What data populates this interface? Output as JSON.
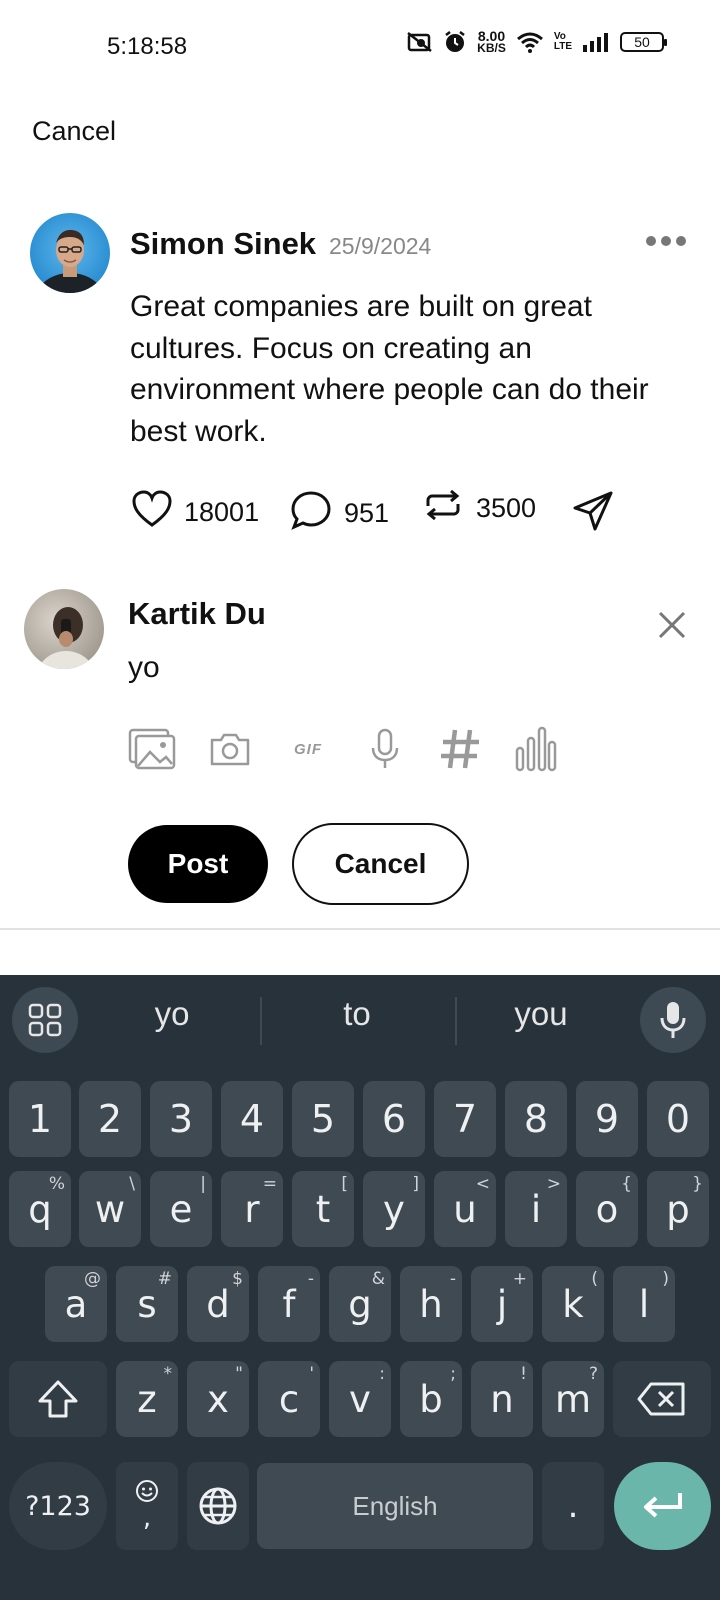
{
  "status_bar": {
    "time": "5:18:58",
    "net_speed_value": "8.00",
    "net_speed_unit": "KB/S",
    "volte_top": "Vo",
    "volte_bottom": "LTE",
    "battery": "50"
  },
  "header": {
    "cancel_label": "Cancel"
  },
  "post": {
    "author": "Simon Sinek",
    "date": "25/9/2024",
    "body": "Great companies are built on great cultures. Focus on creating an environment where people can do their best work.",
    "likes": "18001",
    "comments": "951",
    "reposts": "3500"
  },
  "reply": {
    "author": "Kartik Du",
    "text": "yo",
    "gif_label": "GIF",
    "post_label": "Post",
    "cancel_label": "Cancel"
  },
  "keyboard": {
    "suggestions": [
      "yo",
      "to",
      "you"
    ],
    "number_row": [
      "1",
      "2",
      "3",
      "4",
      "5",
      "6",
      "7",
      "8",
      "9",
      "0"
    ],
    "row1": [
      {
        "key": "q",
        "hint": "%"
      },
      {
        "key": "w",
        "hint": "\\"
      },
      {
        "key": "e",
        "hint": "|"
      },
      {
        "key": "r",
        "hint": "="
      },
      {
        "key": "t",
        "hint": "["
      },
      {
        "key": "y",
        "hint": "]"
      },
      {
        "key": "u",
        "hint": "<"
      },
      {
        "key": "i",
        "hint": ">"
      },
      {
        "key": "o",
        "hint": "{"
      },
      {
        "key": "p",
        "hint": "}"
      }
    ],
    "row2": [
      {
        "key": "a",
        "hint": "@"
      },
      {
        "key": "s",
        "hint": "#"
      },
      {
        "key": "d",
        "hint": "$"
      },
      {
        "key": "f",
        "hint": "-"
      },
      {
        "key": "g",
        "hint": "&"
      },
      {
        "key": "h",
        "hint": "-"
      },
      {
        "key": "j",
        "hint": "+"
      },
      {
        "key": "k",
        "hint": "("
      },
      {
        "key": "l",
        "hint": ")"
      }
    ],
    "row3": [
      {
        "key": "z",
        "hint": "*"
      },
      {
        "key": "x",
        "hint": "\""
      },
      {
        "key": "c",
        "hint": "'"
      },
      {
        "key": "v",
        "hint": ":"
      },
      {
        "key": "b",
        "hint": ";"
      },
      {
        "key": "n",
        "hint": "!"
      },
      {
        "key": "m",
        "hint": "?"
      }
    ],
    "symbols_label": "?123",
    "comma_label": ",",
    "space_label": "English",
    "period_label": "."
  },
  "icons": {
    "status": [
      "no-sim-icon",
      "alarm-icon",
      "wifi-icon",
      "signal-icon",
      "battery-icon"
    ],
    "post_actions": [
      "heart-icon",
      "comment-icon",
      "repost-icon",
      "share-icon"
    ],
    "reply_tools": [
      "image-icon",
      "camera-icon",
      "gif-icon",
      "mic-icon",
      "hashtag-icon",
      "poll-icon"
    ]
  }
}
